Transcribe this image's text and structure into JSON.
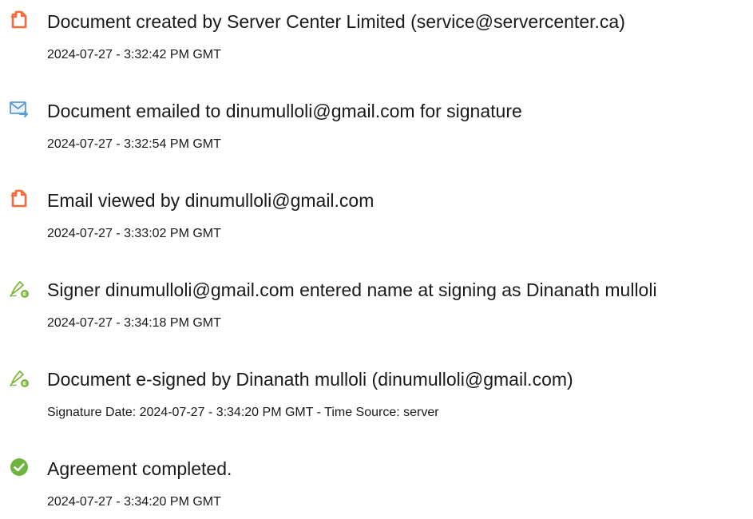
{
  "events": [
    {
      "icon": "document-created-icon",
      "title": "Document created by Server Center Limited (service@servercenter.ca)",
      "meta": "2024-07-27 - 3:32:42 PM GMT"
    },
    {
      "icon": "email-sent-icon",
      "title": "Document emailed to dinumulloli@gmail.com for signature",
      "meta": "2024-07-27 - 3:32:54 PM GMT"
    },
    {
      "icon": "document-viewed-icon",
      "title": "Email viewed by dinumulloli@gmail.com",
      "meta": "2024-07-27 - 3:33:02 PM GMT"
    },
    {
      "icon": "pen-sign-icon",
      "title": "Signer dinumulloli@gmail.com entered name at signing as Dinanath mulloli",
      "meta": "2024-07-27 - 3:34:18 PM GMT"
    },
    {
      "icon": "pen-sign-icon",
      "title": "Document e-signed by Dinanath mulloli (dinumulloli@gmail.com)",
      "meta": "Signature Date: 2024-07-27 - 3:34:20 PM GMT - Time Source: server"
    },
    {
      "icon": "check-circle-icon",
      "title": "Agreement completed.",
      "meta": "2024-07-27 - 3:34:20 PM GMT"
    }
  ],
  "colors": {
    "document_icon": "#f26b3a",
    "email_icon": "#5a9bd6",
    "pen_icon": "#7fb53d",
    "check_icon": "#6fb43f",
    "text": "#1a1a1a"
  }
}
